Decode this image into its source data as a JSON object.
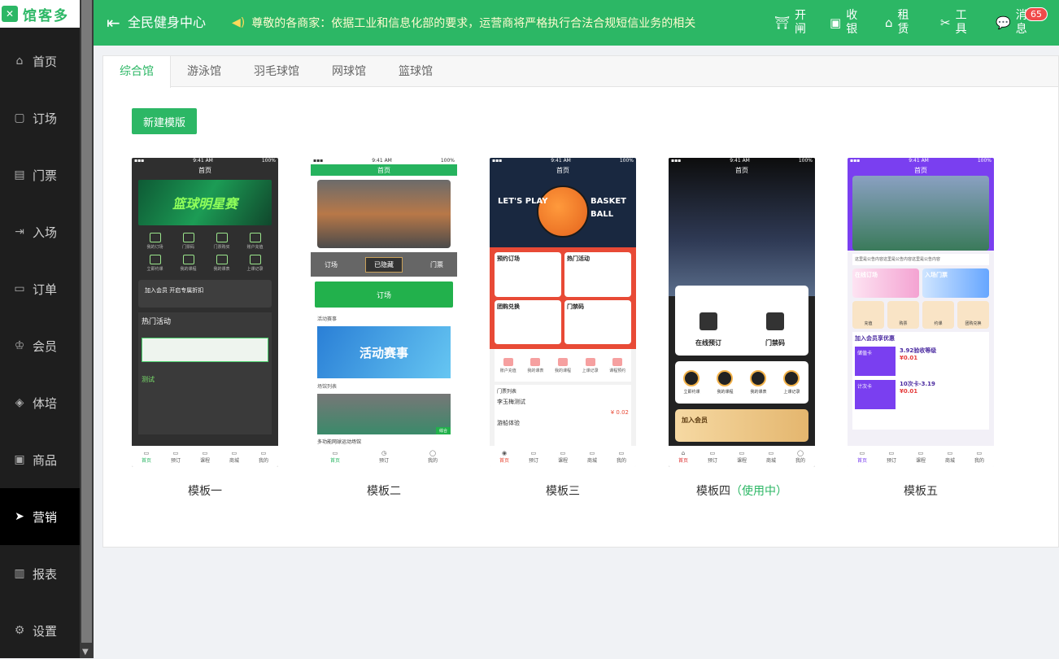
{
  "app": {
    "logo_text": "馆客多"
  },
  "sidebar": {
    "items": [
      {
        "label": "首页",
        "icon": "home-icon"
      },
      {
        "label": "订场",
        "icon": "court-icon"
      },
      {
        "label": "门票",
        "icon": "ticket-icon"
      },
      {
        "label": "入场",
        "icon": "entry-icon"
      },
      {
        "label": "订单",
        "icon": "order-icon"
      },
      {
        "label": "会员",
        "icon": "member-icon"
      },
      {
        "label": "体培",
        "icon": "training-icon"
      },
      {
        "label": "商品",
        "icon": "goods-icon"
      },
      {
        "label": "营销",
        "icon": "marketing-icon",
        "active": true
      },
      {
        "label": "报表",
        "icon": "report-icon"
      },
      {
        "label": "设置",
        "icon": "settings-icon"
      }
    ]
  },
  "header": {
    "title": "全民健身中心",
    "notice": "尊敬的各商家：依据工业和信息化部的要求，运营商将严格执行合法合规短信业务的相关规定",
    "actions": [
      {
        "label": "开闸",
        "icon": "gate-icon"
      },
      {
        "label": "收银",
        "icon": "cashier-icon"
      },
      {
        "label": "租赁",
        "icon": "rent-icon"
      },
      {
        "label": "工具",
        "icon": "tools-icon"
      },
      {
        "label": "消息",
        "icon": "message-icon",
        "badge": "65"
      }
    ]
  },
  "tabs": [
    "综合馆",
    "游泳馆",
    "羽毛球馆",
    "网球馆",
    "篮球馆"
  ],
  "new_template_button": "新建模版",
  "templates": [
    {
      "caption": "模板一"
    },
    {
      "caption": "模板二"
    },
    {
      "caption": "模板三"
    },
    {
      "caption": "模板四",
      "status": "（使用中）"
    },
    {
      "caption": "模板五"
    }
  ],
  "phone": {
    "time": "9:41 AM",
    "battery": "100%",
    "header": "首页",
    "nav": [
      "首页",
      "预订",
      "课程",
      "商城",
      "我的"
    ]
  },
  "t1": {
    "banner": "篮球明星赛",
    "grid": [
      "我的订场",
      "门票码",
      "门票购买",
      "账户充值",
      "立即约课",
      "我的课程",
      "我的课表",
      "上课记录"
    ],
    "vip": "加入会员 开启专属折扣",
    "hot": "热门活动",
    "activity": "测试"
  },
  "t2": {
    "strip": [
      "订场",
      "已隐藏",
      "门票"
    ],
    "book": "订场",
    "activity_label": "活动赛事",
    "activity_banner": "活动赛事",
    "venue_label": "场馆列表",
    "venue_tag": "综合",
    "venue_name": "多功能网球运动场馆"
  },
  "t3": {
    "left": "LET'S PLAY",
    "right": "BASKET BALL",
    "boxes": [
      "预约订场",
      "热门活动",
      "团购兑换",
      "门禁码"
    ],
    "icons": [
      "账户充值",
      "我的课表",
      "我的课程",
      "上课记录",
      "课程预约"
    ],
    "list_title": "门票列表",
    "item1": "李玉梅测试",
    "price1": "¥ 0.02",
    "item2": "游船体验"
  },
  "t4": {
    "online": "在线预订",
    "door": "门禁码",
    "row": [
      "立即约课",
      "我的课程",
      "我的课表",
      "上课记录"
    ],
    "vip": "加入会员"
  },
  "t5": {
    "notice": "这里是公告内容这里是公告内容这里是公告内容",
    "pink": [
      "在线订场",
      "入场门票"
    ],
    "four": [
      "充值",
      "购票",
      "约课",
      "团购兑换"
    ],
    "vip_title": "加入会员享优惠",
    "cards": [
      {
        "tag": "储值卡",
        "name": "3.92验收等级",
        "price": "¥0.01"
      },
      {
        "tag": "计次卡",
        "name": "10次卡-3.19",
        "price": "¥0.01"
      }
    ]
  }
}
